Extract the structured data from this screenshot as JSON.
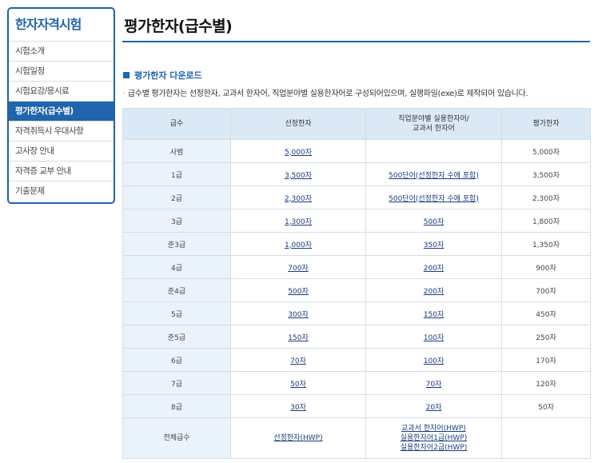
{
  "sidebar": {
    "title": "한자자격시험",
    "items": [
      "시험소개",
      "시험일정",
      "시험요강/응시료",
      "평가한자(급수별)",
      "자격취득시 우대사항",
      "고사장 안내",
      "자격증 교부 안내",
      "기출문제"
    ]
  },
  "page": {
    "title": "평가한자(급수별)",
    "section_title": "평가한자 다운로드",
    "description": "급수별 평가한자는 선정한자, 교과서 한자어, 직업분야별 실용한자어로 구성되어있으며, 실행파일(exe)로 제작되어 있습니다."
  },
  "table": {
    "headers": {
      "grade": "급수",
      "selected": "선정한자",
      "practical_line1": "직업분야별 실용한자어/",
      "practical_line2": "교과서 한자어",
      "evaluation": "평가한자"
    },
    "rows": [
      {
        "grade": "사범",
        "selected": "5,000자",
        "practical": "",
        "evaluation": "5,000자"
      },
      {
        "grade": "1급",
        "selected": "3,500자",
        "practical": "500단어(선정한자 수에 포함)",
        "evaluation": "3,500자"
      },
      {
        "grade": "2급",
        "selected": "2,300자",
        "practical": "500단어(선정한자 수에 포함)",
        "evaluation": "2,300자"
      },
      {
        "grade": "3급",
        "selected": "1,300자",
        "practical": "500자",
        "evaluation": "1,800자"
      },
      {
        "grade": "준3급",
        "selected": "1,000자",
        "practical": "350자",
        "evaluation": "1,350자"
      },
      {
        "grade": "4급",
        "selected": "700자",
        "practical": "200자",
        "evaluation": "900자"
      },
      {
        "grade": "준4급",
        "selected": "500자",
        "practical": "200자",
        "evaluation": "700자"
      },
      {
        "grade": "5급",
        "selected": "300자",
        "practical": "150자",
        "evaluation": "450자"
      },
      {
        "grade": "준5급",
        "selected": "150자",
        "practical": "100자",
        "evaluation": "250자"
      },
      {
        "grade": "6급",
        "selected": "70자",
        "practical": "100자",
        "evaluation": "170자"
      },
      {
        "grade": "7급",
        "selected": "50자",
        "practical": "70자",
        "evaluation": "120자"
      },
      {
        "grade": "8급",
        "selected": "30자",
        "practical": "20자",
        "evaluation": "50자"
      }
    ],
    "all_grades": {
      "grade": "전체급수",
      "selected": "선정한자(HWP)",
      "practical_1": "교과서 한자어(HWP)",
      "practical_2": "실용한자어1급(HWP)",
      "practical_3": "실용한자어2급(HWP)",
      "evaluation": ""
    }
  }
}
